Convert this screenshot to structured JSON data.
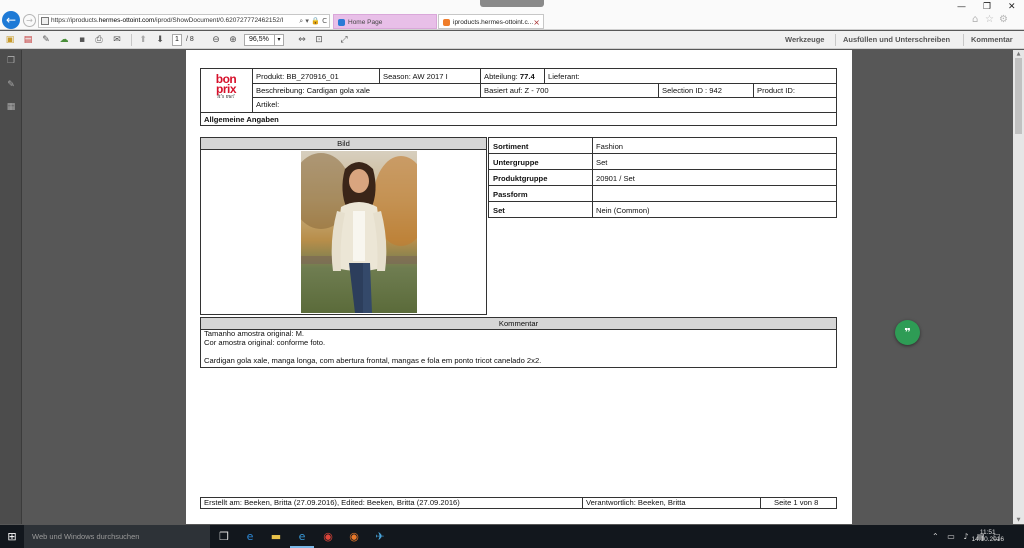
{
  "browser": {
    "url_prefix": "https://iproducts.",
    "url_domain": "hermes-ottoint.com",
    "url_suffix": "/iprod/ShowDocument/0.620727772462152/I",
    "address_tools": "⌕ ▾ 🔒 C",
    "tabs": [
      {
        "label": "Home Page",
        "color": "#2a7ad6"
      },
      {
        "label": "iproducts.hermes-ottoint.c...",
        "color": "#f07d2a",
        "close": "×"
      }
    ],
    "window_controls": {
      "minimize": "—",
      "maximize": "❐",
      "close": "✕"
    }
  },
  "pdf_toolbar": {
    "page_current": "1",
    "page_total": "/ 8",
    "zoom": "96,5%",
    "links": [
      "Werkzeuge",
      "Ausfüllen und Unterschreiben",
      "Kommentar"
    ]
  },
  "document": {
    "logo": {
      "line1": "bon",
      "line2": "prix",
      "tagline": "it's me!"
    },
    "header": {
      "produkt": "Produkt: BB_270916_01",
      "season": "Season: AW 2017 I",
      "abteilung_label": "Abteilung:",
      "abteilung_value": "77.4",
      "lieferant": "Lieferant:",
      "beschreibung": "Beschreibung: Cardigan gola xale",
      "basiert": "Basiert auf: Z - 700",
      "selection": "Selection ID : 942",
      "product_id": "Product ID:",
      "artikel": "Artikel:"
    },
    "section_title": "Allgemeine Angaben",
    "image_section": {
      "title": "Bild"
    },
    "attributes": [
      {
        "label": "Sortiment",
        "value": "Fashion"
      },
      {
        "label": "Untergruppe",
        "value": "Set"
      },
      {
        "label": "Produktgruppe",
        "value": "20901 / Set"
      },
      {
        "label": "Passform",
        "value": ""
      },
      {
        "label": "Set",
        "value": "Nein (Common)"
      }
    ],
    "comment": {
      "title": "Kommentar",
      "line1": "Tamanho amostra original: M.",
      "line2": "Cor amostra original: conforme foto.",
      "line3": "Cardigan gola xale, manga longa, com abertura frontal, mangas e fola em ponto tricot canelado 2x2."
    },
    "footer": {
      "erstellt": "Erstellt am: Beeken, Britta (27.09.2016), Edited: Beeken, Britta (27.09.2016)",
      "verantwortlich": "Verantwortlich: Beeken, Britta",
      "seite": "Seite 1 von 8"
    }
  },
  "taskbar": {
    "search_placeholder": "Web und Windows durchsuchen",
    "clock_time": "11:51",
    "clock_date": "14.10.2016"
  }
}
